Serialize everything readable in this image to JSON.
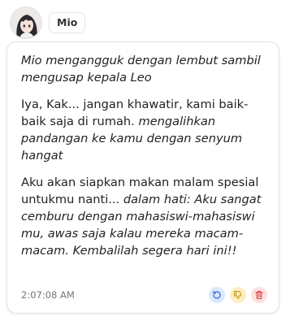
{
  "character": {
    "name": "Mio"
  },
  "message": {
    "paragraphs": [
      {
        "segments": [
          {
            "text": "Mio mengangguk dengan lembut sambil mengusap kepala Leo",
            "italic": true
          }
        ]
      },
      {
        "segments": [
          {
            "text": "Iya, Kak... jangan khawatir, kami baik-baik saja di rumah. ",
            "italic": false
          },
          {
            "text": "mengalihkan pandangan ke kamu dengan senyum hangat",
            "italic": true
          }
        ]
      },
      {
        "segments": [
          {
            "text": "Aku akan siapkan makan malam spesial untukmu nanti... ",
            "italic": false
          },
          {
            "text": "dalam hati: Aku sangat cemburu dengan mahasiswi-mahasiswi mu, awas saja kalau mereka macam-macam. Kembalilah segera hari ini!!",
            "italic": true
          }
        ]
      }
    ],
    "timestamp": "2:07:08 AM"
  },
  "actions": {
    "regenerate_icon": "refresh-icon",
    "dislike_icon": "thumbs-down-icon",
    "delete_icon": "trash-icon"
  },
  "colors": {
    "regenerate": "#3b6fd6",
    "dislike": "#c99a1a",
    "delete": "#d94040"
  }
}
